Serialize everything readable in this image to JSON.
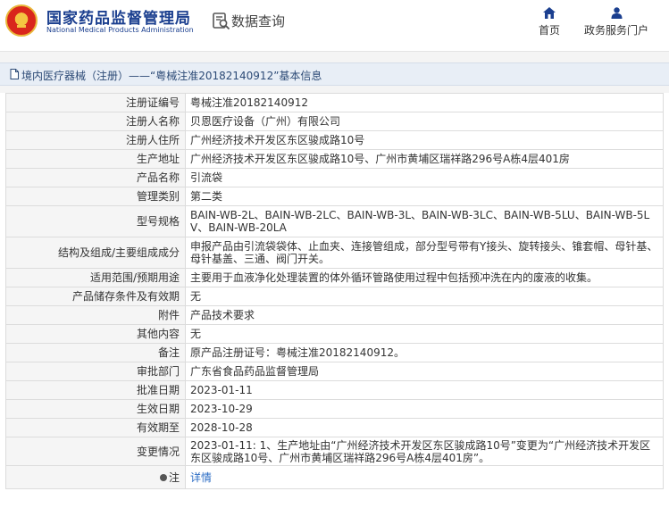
{
  "header": {
    "org_cn": "国家药品监督管理局",
    "org_en": "National Medical Products Administration",
    "data_query_label": "数据查询",
    "nav": {
      "home_label": "首页",
      "service_label": "政务服务门户"
    },
    "colors": {
      "brand": "#1b3f8f",
      "emblem_red": "#d9261c",
      "emblem_gold": "#f4c542"
    }
  },
  "breadcrumb": {
    "text": "境内医疗器械（注册）——“粤械注准20182140912”基本信息"
  },
  "detail": {
    "rows": [
      {
        "label": "注册证编号",
        "value": "粤械注准20182140912"
      },
      {
        "label": "注册人名称",
        "value": "贝恩医疗设备（广州）有限公司"
      },
      {
        "label": "注册人住所",
        "value": "广州经济技术开发区东区骏成路10号"
      },
      {
        "label": "生产地址",
        "value": "广州经济技术开发区东区骏成路10号、广州市黄埔区瑞祥路296号A栋4层401房"
      },
      {
        "label": "产品名称",
        "value": "引流袋"
      },
      {
        "label": "管理类别",
        "value": "第二类"
      },
      {
        "label": "型号规格",
        "value": "BAIN-WB-2L、BAIN-WB-2LC、BAIN-WB-3L、BAIN-WB-3LC、BAIN-WB-5LU、BAIN-WB-5LV、BAIN-WB-20LA"
      },
      {
        "label": "结构及组成/主要组成成分",
        "value": "申报产品由引流袋袋体、止血夹、连接管组成，部分型号带有Y接头、旋转接头、锥套帽、母针基、母针基盖、三通、阀门开关。"
      },
      {
        "label": "适用范围/预期用途",
        "value": "主要用于血液净化处理装置的体外循环管路使用过程中包括预冲洗在内的废液的收集。"
      },
      {
        "label": "产品储存条件及有效期",
        "value": "无"
      },
      {
        "label": "附件",
        "value": "产品技术要求"
      },
      {
        "label": "其他内容",
        "value": "无"
      },
      {
        "label": "备注",
        "value": "原产品注册证号：粤械注准20182140912。"
      },
      {
        "label": "审批部门",
        "value": "广东省食品药品监督管理局"
      },
      {
        "label": "批准日期",
        "value": "2023-01-11"
      },
      {
        "label": "生效日期",
        "value": "2023-10-29"
      },
      {
        "label": "有效期至",
        "value": "2028-10-28"
      },
      {
        "label": "变更情况",
        "value": "2023-01-11: 1、生产地址由“广州经济技术开发区东区骏成路10号”变更为“广州经济技术开发区东区骏成路10号、广州市黄埔区瑞祥路296号A栋4层401房”。"
      }
    ],
    "note": {
      "label": "注",
      "link_text": "详情"
    }
  }
}
